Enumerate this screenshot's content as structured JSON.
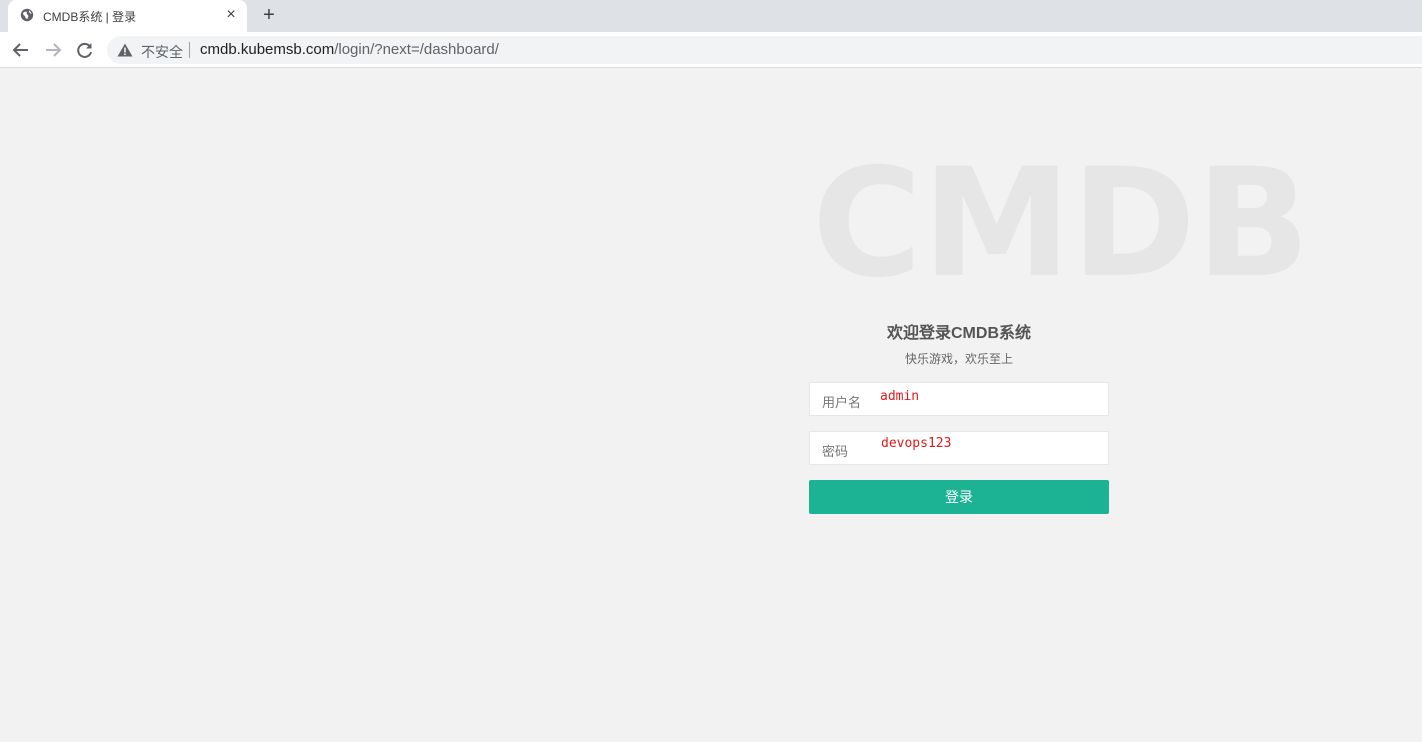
{
  "browser": {
    "tab": {
      "title": "CMDB系统 | 登录",
      "close": "×"
    },
    "new_tab": "+",
    "address_bar": {
      "security_label": "不安全",
      "url_host": "cmdb.kubemsb.com",
      "url_path": "/login/?next=/dashboard/"
    }
  },
  "page": {
    "watermark": "CMDB",
    "title": "欢迎登录CMDB系统",
    "subtitle": "快乐游戏，欢乐至上",
    "form": {
      "username_label": "用户名",
      "username_value": "admin",
      "password_label": "密码",
      "password_value": "devops123",
      "submit_label": "登录"
    },
    "colors": {
      "accent": "#1bb394",
      "annotation": "#e01a1a",
      "background": "#f2f2f2"
    }
  }
}
